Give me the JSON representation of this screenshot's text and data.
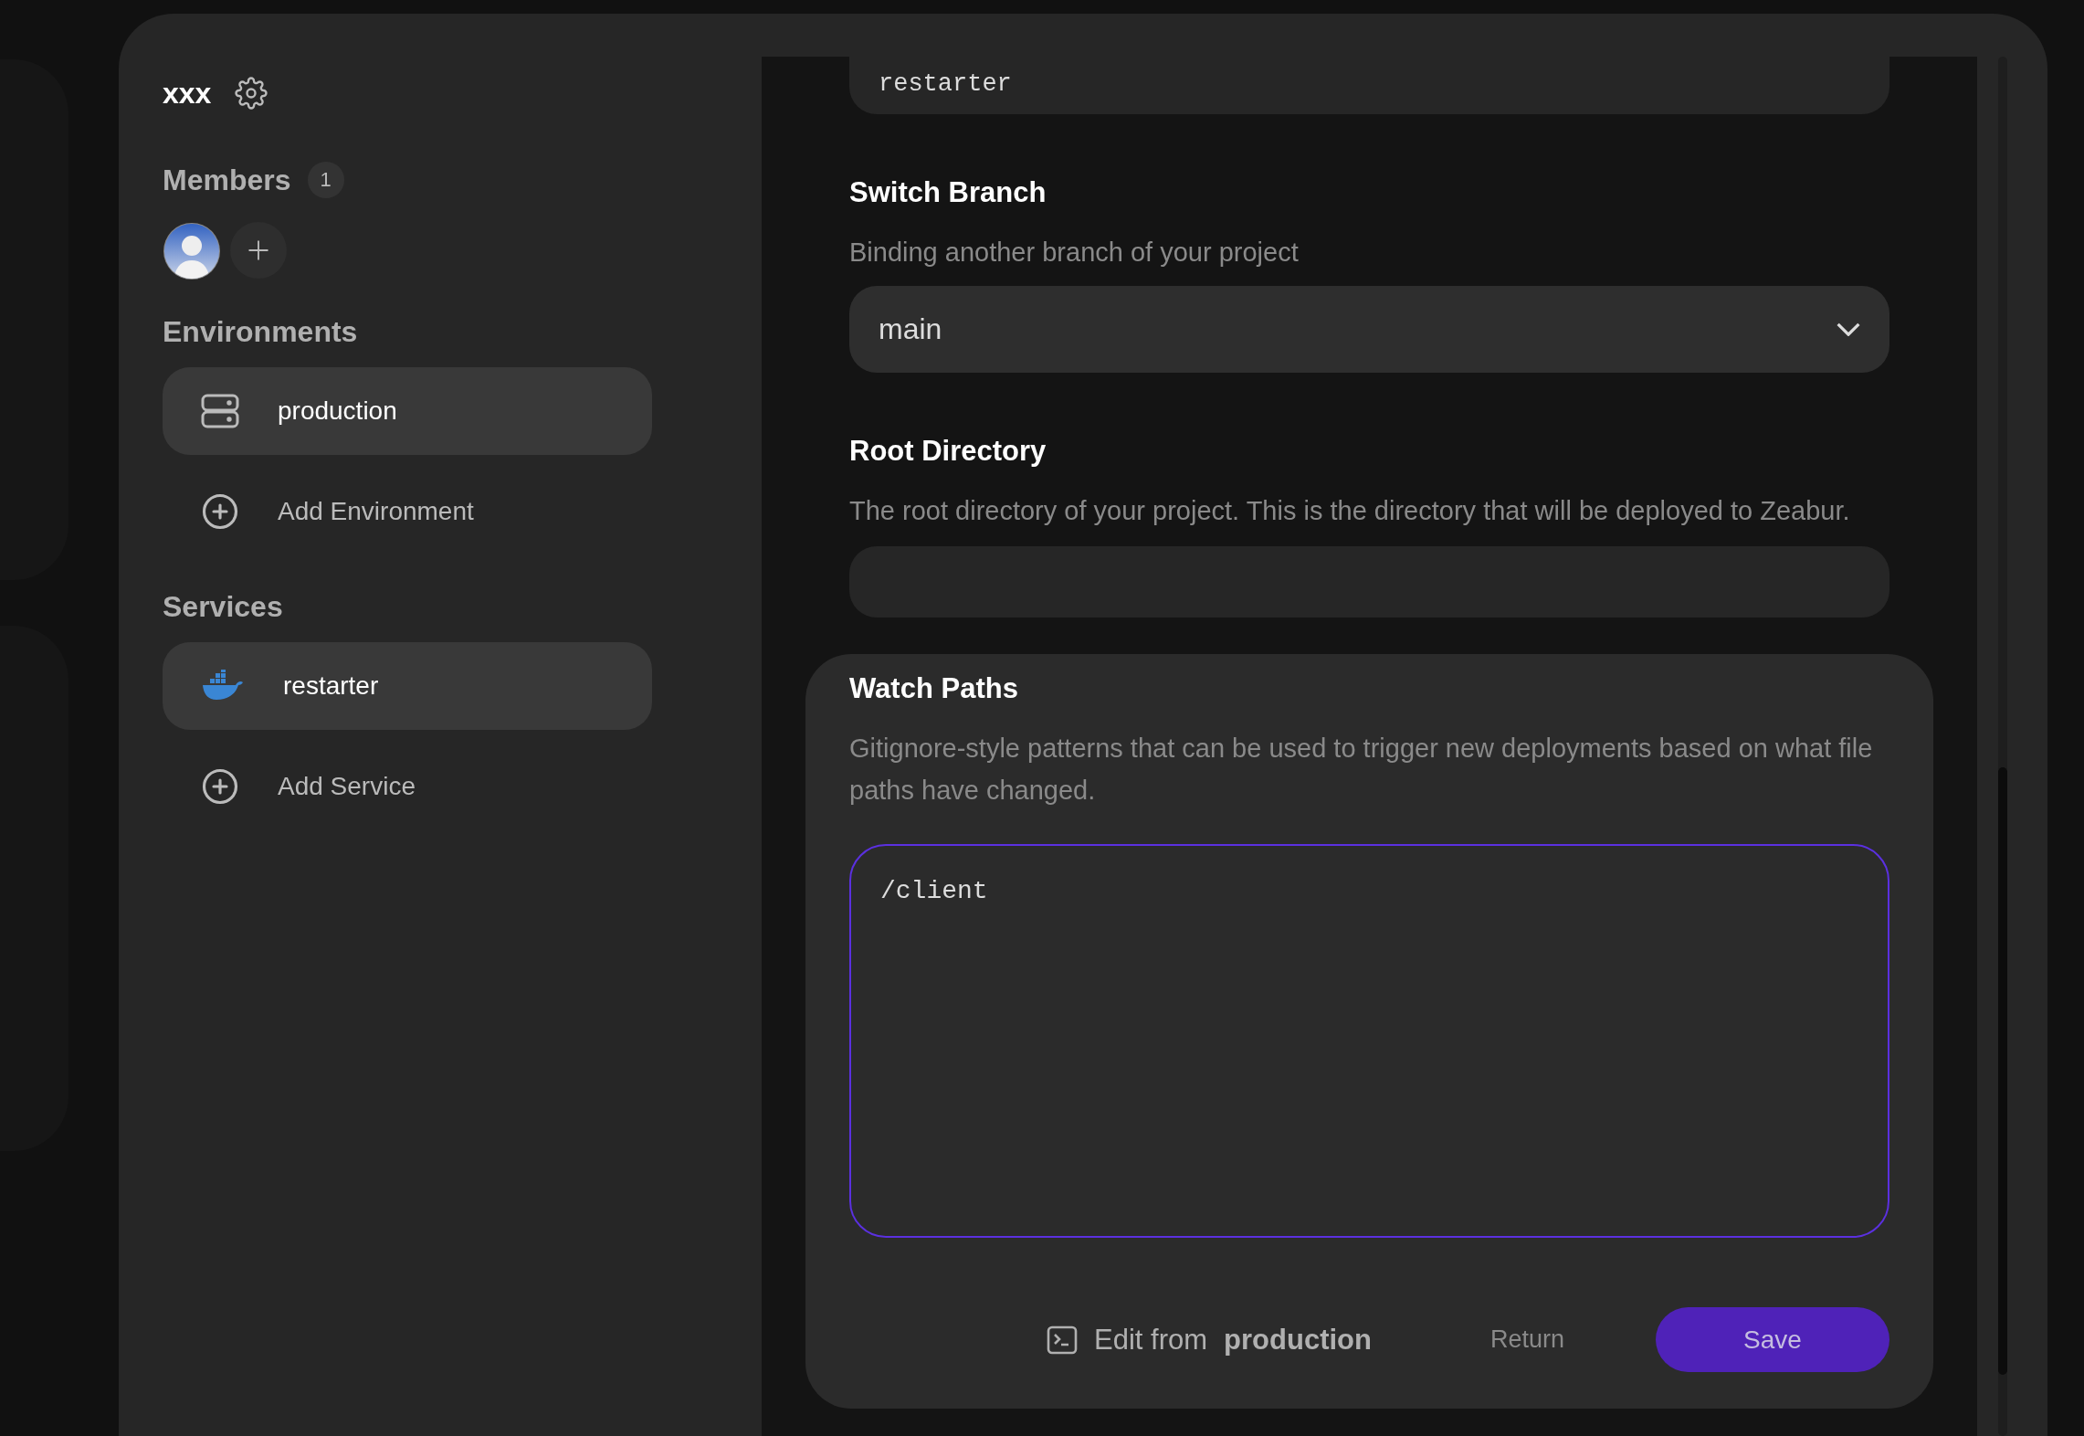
{
  "project": {
    "name": "xxx"
  },
  "members": {
    "heading": "Members",
    "count": "1"
  },
  "environments": {
    "heading": "Environments",
    "add_label": "Add Environment",
    "items": [
      {
        "label": "production",
        "selected": true
      }
    ]
  },
  "services": {
    "heading": "Services",
    "add_label": "Add Service",
    "items": [
      {
        "label": "restarter",
        "selected": true
      }
    ]
  },
  "settings": {
    "name_field": {
      "value": "restarter"
    },
    "switch_branch": {
      "title": "Switch Branch",
      "description": "Binding another branch of your project",
      "value": "main"
    },
    "root_directory": {
      "title": "Root Directory",
      "description": "The root directory of your project. This is the directory that will be deployed to Zeabur."
    },
    "watch_paths": {
      "title": "Watch Paths",
      "description": "Gitignore-style patterns that can be used to trigger new deployments based on what file paths have changed.",
      "value": "/client",
      "focused": true,
      "edit_from_label": "Edit from",
      "edit_from_env": "production",
      "return_label": "Return",
      "save_label": "Save"
    }
  }
}
